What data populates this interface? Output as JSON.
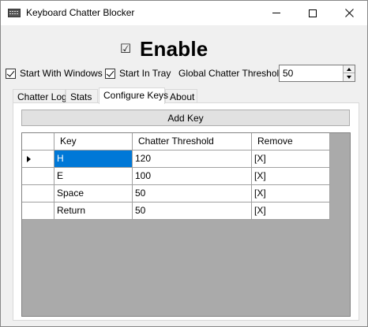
{
  "window": {
    "title": "Keyboard Chatter Blocker",
    "icon": "keyboard-icon"
  },
  "enable": {
    "checked": true,
    "check_glyph": "☑",
    "label": "Enable"
  },
  "options": {
    "start_with_windows": {
      "label": "Start With Windows",
      "checked": true
    },
    "start_in_tray": {
      "label": "Start In Tray",
      "checked": true
    },
    "global_threshold": {
      "label": "Global Chatter Threshold:",
      "value": "50"
    }
  },
  "tabs": [
    {
      "label": "Chatter Log",
      "active": false
    },
    {
      "label": "Stats",
      "active": false
    },
    {
      "label": "Configure Keys",
      "active": true
    },
    {
      "label": "About",
      "active": false
    }
  ],
  "configure_keys": {
    "add_key_label": "Add Key",
    "columns": [
      "Key",
      "Chatter Threshold",
      "Remove"
    ],
    "rows": [
      {
        "key": "H",
        "threshold": "120",
        "remove": "[X]",
        "current": true,
        "selected_cell": "key"
      },
      {
        "key": "E",
        "threshold": "100",
        "remove": "[X]"
      },
      {
        "key": "Space",
        "threshold": "50",
        "remove": "[X]"
      },
      {
        "key": "Return",
        "threshold": "50",
        "remove": "[X]"
      }
    ]
  },
  "colors": {
    "selection": "#0078d7",
    "grid_background": "#aaaaaa",
    "window_background": "#f0f0f0"
  }
}
